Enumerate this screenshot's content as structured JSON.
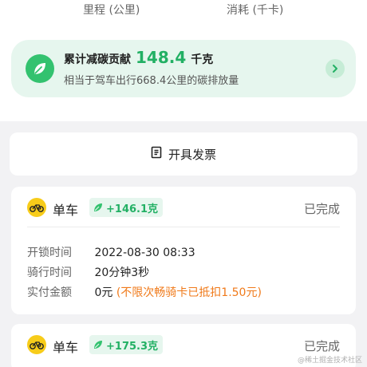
{
  "stats": {
    "distance_label": "里程 (公里)",
    "calories_label": "消耗 (千卡)"
  },
  "carbon": {
    "title": "累计减碳贡献",
    "value": "148.4",
    "unit": "千克",
    "subtitle": "相当于驾车出行668.4公里的碳排放量",
    "accent_color": "#22b064",
    "icon": "leaf-icon"
  },
  "invoice": {
    "label": "开具发票",
    "icon": "invoice-icon"
  },
  "rides": [
    {
      "type": "单车",
      "carbon_badge": "+146.1克",
      "status": "已完成",
      "icon": "bike-icon",
      "details": {
        "unlock_label": "开锁时间",
        "unlock_value": "2022-08-30 08:33",
        "duration_label": "骑行时间",
        "duration_value": "20分钟3秒",
        "payment_label": "实付金额",
        "payment_value": "0元",
        "payment_note": "(不限次畅骑卡已抵扣1.50元)"
      }
    },
    {
      "type": "单车",
      "carbon_badge": "+175.3克",
      "status": "已完成",
      "icon": "bike-icon"
    }
  ],
  "watermark": "@稀土掘金技术社区"
}
